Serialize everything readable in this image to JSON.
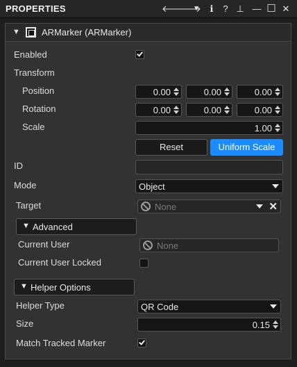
{
  "titlebar": {
    "title": "PROPERTIES",
    "icons": [
      "arrow-left-icon",
      "arrow-right-icon",
      "dropdown-icon",
      "info-icon",
      "help-icon",
      "pin-icon",
      "minimize-icon",
      "maximize-icon",
      "close-icon"
    ],
    "glyphs": {
      "back": "🡐",
      "forward": "🡒",
      "menu": "▼",
      "info": "ℹ",
      "help": "?",
      "pin": "⊥",
      "min": "—",
      "max": "☐",
      "close": "✕"
    }
  },
  "component": {
    "title": "ARMarker (ARMarker)",
    "caret": "▼"
  },
  "enabled": {
    "label": "Enabled",
    "checked": true
  },
  "transform": {
    "label": "Transform",
    "position": {
      "label": "Position",
      "x": "0.00",
      "y": "0.00",
      "z": "0.00"
    },
    "rotation": {
      "label": "Rotation",
      "x": "0.00",
      "y": "0.00",
      "z": "0.00"
    },
    "scale": {
      "label": "Scale",
      "value": "1.00"
    },
    "reset_label": "Reset",
    "uniform_label": "Uniform Scale"
  },
  "id_field": {
    "label": "ID",
    "value": ""
  },
  "mode": {
    "label": "Mode",
    "value": "Object"
  },
  "target": {
    "label": "Target",
    "value": "None"
  },
  "advanced": {
    "label": "Advanced",
    "caret": "▼",
    "current_user": {
      "label": "Current User",
      "value": "None"
    },
    "current_user_locked": {
      "label": "Current User Locked",
      "checked": false
    }
  },
  "helper": {
    "label": "Helper Options",
    "caret": "▼",
    "type": {
      "label": "Helper Type",
      "value": "QR Code"
    },
    "size": {
      "label": "Size",
      "value": "0.15"
    },
    "match_tracked": {
      "label": "Match Tracked Marker",
      "checked": true
    }
  },
  "colors": {
    "accent": "#1a8cff",
    "background": "#1e1e1e",
    "panel": "#323232"
  }
}
